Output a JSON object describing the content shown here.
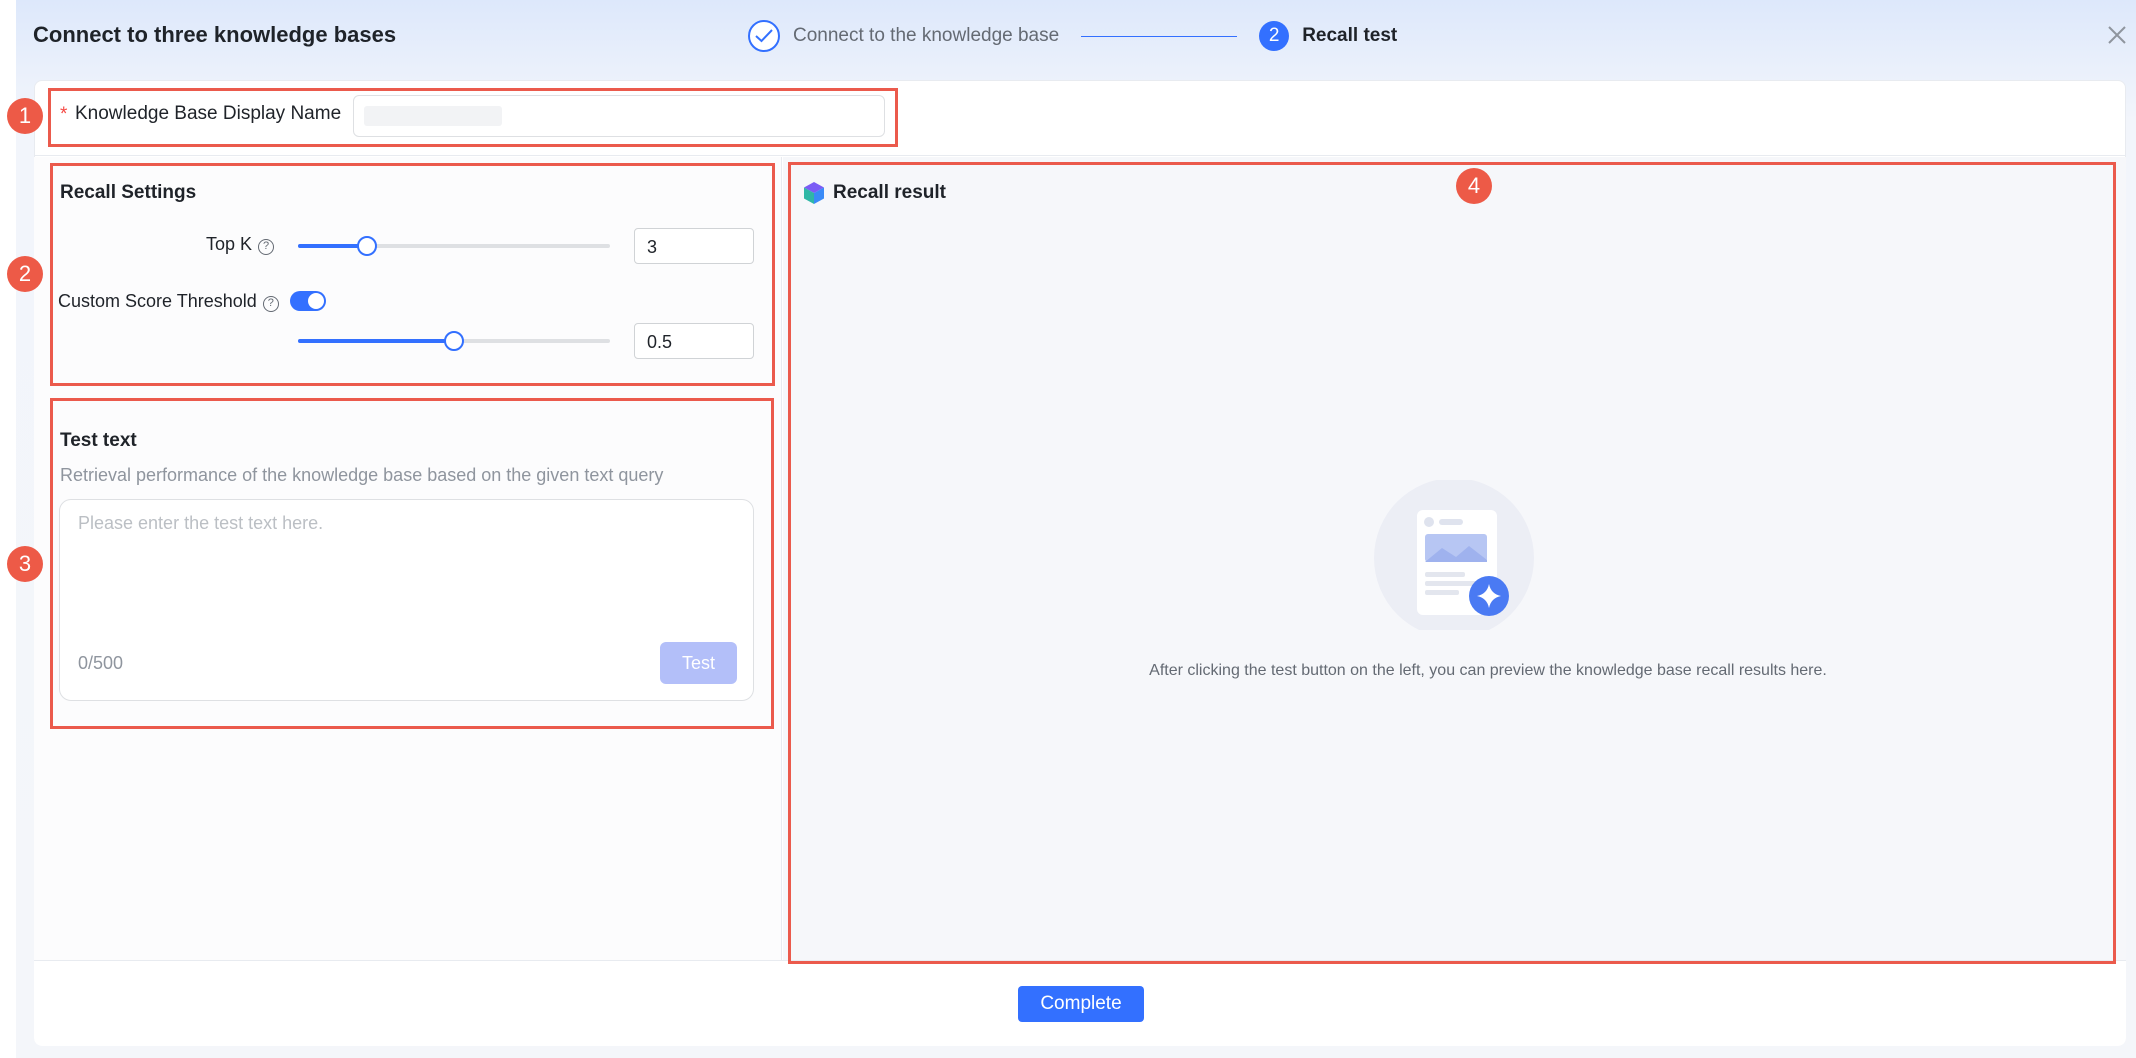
{
  "header": {
    "title": "Connect to three knowledge bases",
    "steps": [
      {
        "label": "Connect to the knowledge base",
        "state": "done"
      },
      {
        "number": "2",
        "label": "Recall test",
        "state": "active"
      }
    ],
    "close_icon": "close-icon"
  },
  "name_field": {
    "required_mark": "*",
    "label": "Knowledge Base Display Name",
    "value": ""
  },
  "recall_settings": {
    "title": "Recall Settings",
    "top_k": {
      "label": "Top K",
      "value": "3",
      "slider_fraction": 0.22
    },
    "threshold": {
      "label": "Custom Score Threshold",
      "enabled": true,
      "value": "0.5",
      "slider_fraction": 0.5
    },
    "help_icon": "help-icon"
  },
  "test_text": {
    "title": "Test text",
    "description": "Retrieval performance of the knowledge base based on the given text query",
    "placeholder": "Please enter the test text here.",
    "counter": "0/500",
    "button_label": "Test"
  },
  "recall_result": {
    "title": "Recall result",
    "empty_text": "After clicking the test button on the left, you can preview the knowledge base recall results here."
  },
  "footer": {
    "complete_label": "Complete"
  },
  "annotations": [
    "1",
    "2",
    "3",
    "4"
  ],
  "colors": {
    "accent": "#3370ff",
    "highlight": "#eb5a4c"
  }
}
